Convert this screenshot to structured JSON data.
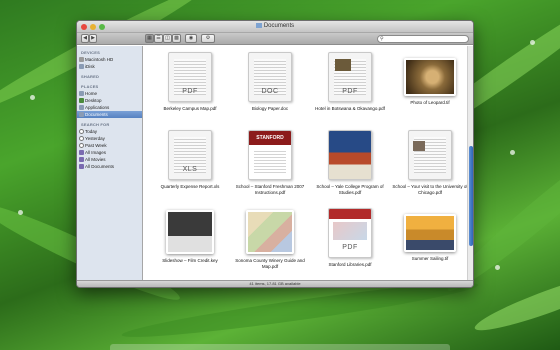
{
  "window": {
    "title": "Documents"
  },
  "toolbar": {
    "search_placeholder": ""
  },
  "sidebar": {
    "sections": [
      {
        "label": "DEVICES",
        "items": [
          {
            "label": "Macintosh HD",
            "icon": "hard-drive-icon"
          },
          {
            "label": "iDisk",
            "icon": "idisk-icon"
          }
        ]
      },
      {
        "label": "SHARED",
        "items": []
      },
      {
        "label": "PLACES",
        "items": [
          {
            "label": "Home",
            "icon": "home-icon"
          },
          {
            "label": "Desktop",
            "icon": "desktop-icon"
          },
          {
            "label": "Applications",
            "icon": "applications-icon"
          },
          {
            "label": "Documents",
            "icon": "documents-icon",
            "selected": true
          }
        ]
      },
      {
        "label": "SEARCH FOR",
        "items": [
          {
            "label": "Today",
            "icon": "clock-icon"
          },
          {
            "label": "Yesterday",
            "icon": "clock-icon"
          },
          {
            "label": "Past Week",
            "icon": "clock-icon"
          },
          {
            "label": "All Images",
            "icon": "smart-folder-icon"
          },
          {
            "label": "All Movies",
            "icon": "smart-folder-icon"
          },
          {
            "label": "All Documents",
            "icon": "smart-folder-icon"
          }
        ]
      }
    ]
  },
  "files": [
    {
      "label": "Berkeley Campus Map.pdf",
      "kind": "doc",
      "badge": "PDF"
    },
    {
      "label": "Biology Paper.doc",
      "kind": "doc",
      "badge": "DOC"
    },
    {
      "label": "Hotel in Botswana & Okavango.pdf",
      "kind": "doc",
      "badge": "PDF"
    },
    {
      "label": "Photo of Leopard.tif",
      "kind": "photo",
      "color": "#8a6a3a"
    },
    {
      "label": "Quarterly Expense Report.xls",
      "kind": "doc",
      "badge": "XLS"
    },
    {
      "label": "School – Stanford Freshman 2007 Instructions.pdf",
      "kind": "doc",
      "badge": "STANFORD",
      "color": "#8c1b1b"
    },
    {
      "label": "School – Yale College Program of Studies.pdf",
      "kind": "doc",
      "badge": "",
      "color": "#274a86"
    },
    {
      "label": "School – Your visit to the University of Chicago.pdf",
      "kind": "doc",
      "badge": ""
    },
    {
      "label": "Slideshow – Film Credit.key",
      "kind": "doc",
      "badge": "",
      "color": "#4a4a4a"
    },
    {
      "label": "Sonoma County Winery Guide and Map.pdf",
      "kind": "doc",
      "badge": ""
    },
    {
      "label": "Stanford Libraries.pdf",
      "kind": "doc",
      "badge": "PDF",
      "color": "#b22a2a"
    },
    {
      "label": "Summer Sailing.tif",
      "kind": "photo",
      "color": "#c98a2a"
    }
  ],
  "status": {
    "text": "41 items, 17.81 GB available"
  }
}
